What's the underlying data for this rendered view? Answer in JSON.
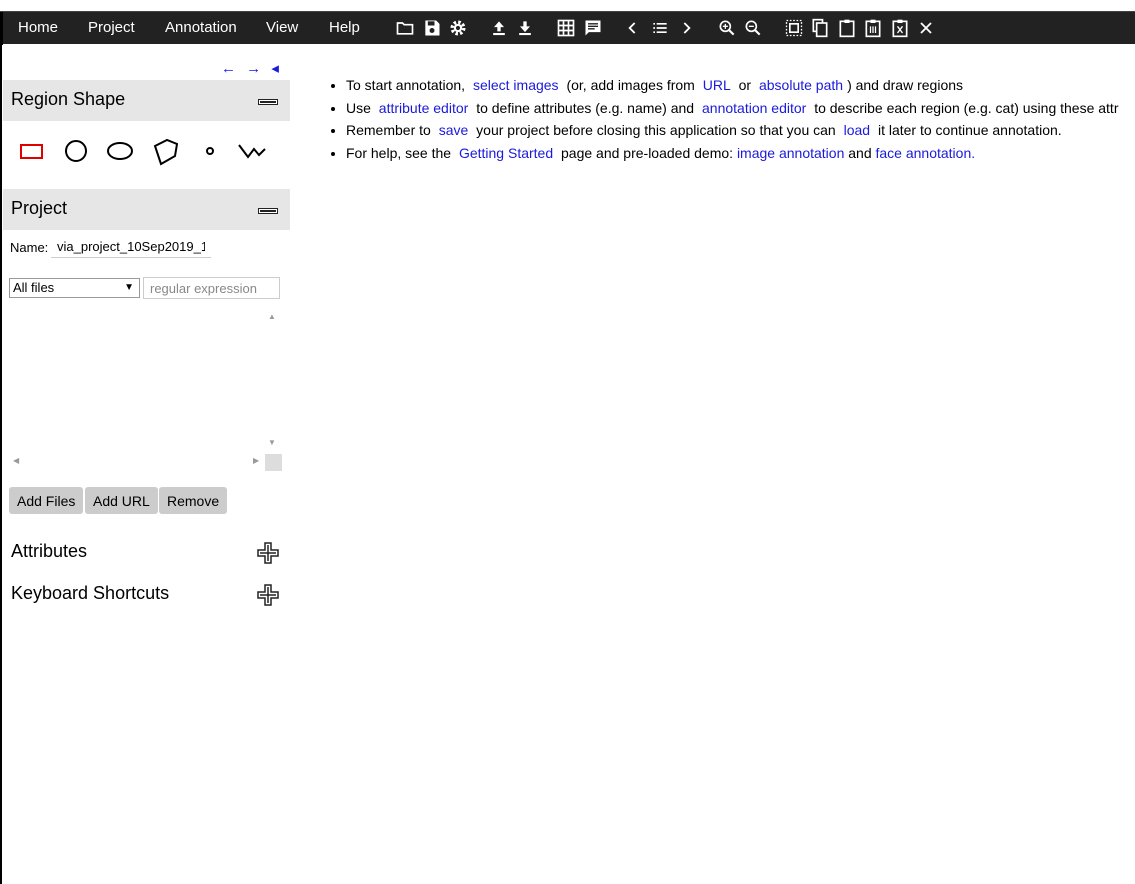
{
  "menu": [
    "Home",
    "Project",
    "Annotation",
    "View",
    "Help"
  ],
  "toolbar_icons": [
    "folder-open-icon",
    "save-icon",
    "gear-icon",
    "upload-icon",
    "download-icon",
    "grid-icon",
    "comment-icon",
    "chevron-left-icon",
    "list-icon",
    "chevron-right-icon",
    "zoom-in-icon",
    "zoom-out-icon",
    "select-all-icon",
    "copy-icon",
    "paste-icon",
    "paste-clear-icon",
    "delete-icon",
    "close-icon"
  ],
  "nav_arrows": [
    "←",
    "→",
    "◂"
  ],
  "region_shape": {
    "title": "Region Shape",
    "shapes": [
      "rectangle",
      "circle",
      "ellipse",
      "polygon",
      "point",
      "polyline"
    ],
    "selected_color": "#e00000"
  },
  "project": {
    "title": "Project",
    "name_label": "Name:",
    "name_value": "via_project_10Sep2019_1",
    "filter_selected": "All files",
    "regex_placeholder": "regular expression",
    "buttons": {
      "add_files": "Add Files",
      "add_url": "Add URL",
      "remove": "Remove"
    }
  },
  "attributes": {
    "title": "Attributes"
  },
  "shortcuts": {
    "title": "Keyboard Shortcuts"
  },
  "instructions": {
    "l1": {
      "a": "To start annotation,",
      "link1": "select images",
      "b": "(or, add images from",
      "link2": "URL",
      "c": "or",
      "link3": "absolute path",
      "d": ") and draw regions"
    },
    "l2": {
      "a": "Use",
      "link1": "attribute editor",
      "b": "to define attributes (e.g. name) and",
      "link2": "annotation editor",
      "c": "to describe each region (e.g. cat) using these attr"
    },
    "l3": {
      "a": "Remember to",
      "link1": "save",
      "b": "your project before closing this application so that you can",
      "link2": "load",
      "c": "it later to continue annotation."
    },
    "l4": {
      "a": "For help, see the",
      "link1": "Getting Started",
      "b": "page and pre-loaded demo:",
      "link2": "image annotation",
      "c": "and",
      "link3": "face annotation",
      "d": "."
    }
  },
  "link_color": "#1a1adb"
}
